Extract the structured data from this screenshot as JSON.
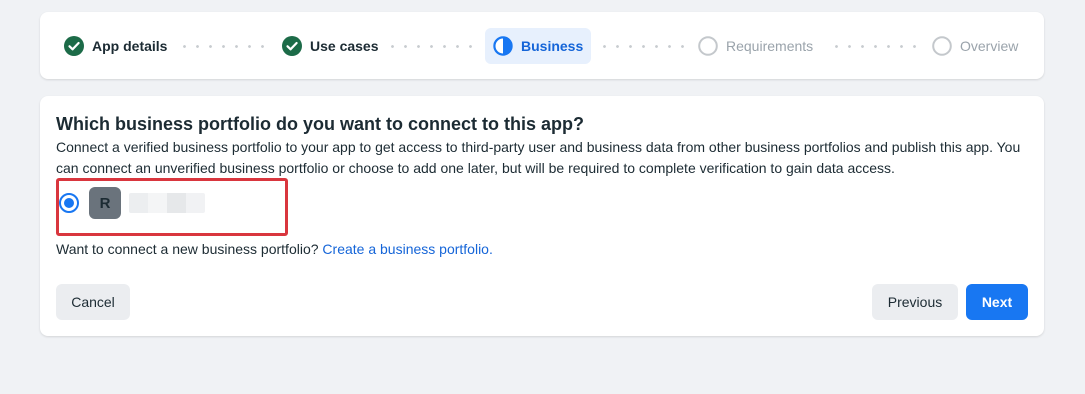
{
  "stepper": {
    "steps": [
      {
        "label": "App details",
        "state": "done"
      },
      {
        "label": "Use cases",
        "state": "done"
      },
      {
        "label": "Business",
        "state": "active"
      },
      {
        "label": "Requirements",
        "state": "todo"
      },
      {
        "label": "Overview",
        "state": "todo"
      }
    ]
  },
  "main": {
    "question": "Which business portfolio do you want to connect to this app?",
    "description": "Connect a verified business portfolio to your app to get access to third-party user and business data from other business portfolios and publish this app. You can connect an unverified business portfolio or choose to add one later, but will be required to complete verification to gain data access.",
    "portfolio_option": {
      "avatar_letter": "R",
      "selected": true
    },
    "connect_prompt": "Want to connect a new business portfolio?",
    "connect_link": "Create a business portfolio.",
    "buttons": {
      "cancel": "Cancel",
      "previous": "Previous",
      "next": "Next"
    }
  },
  "colors": {
    "accent": "#1877f2",
    "done_check": "#1c6b48",
    "highlight_border": "#d9363e",
    "page_background": "#f0f2f5"
  }
}
